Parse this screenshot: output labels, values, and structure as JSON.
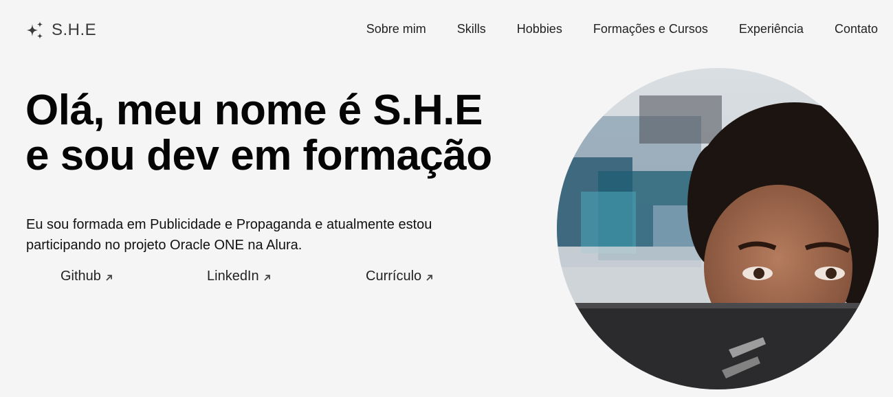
{
  "brand": {
    "name": "S.H.E",
    "icon": "sparkles-icon"
  },
  "nav": [
    {
      "label": "Sobre mim"
    },
    {
      "label": "Skills"
    },
    {
      "label": "Hobbies"
    },
    {
      "label": "Formações e Cursos"
    },
    {
      "label": "Experiência"
    },
    {
      "label": "Contato"
    }
  ],
  "hero": {
    "title_line1": "Olá, meu nome é S.H.E",
    "title_line2": "e sou dev em formação",
    "description_line1": "Eu sou formada em Publicidade e Propaganda e atualmente estou",
    "description_line2": "participando no projeto Oracle ONE na Alura.",
    "links": [
      {
        "label": "Github",
        "icon": "arrow-up-right-icon"
      },
      {
        "label": "LinkedIn",
        "icon": "arrow-up-right-icon"
      },
      {
        "label": "Currículo",
        "icon": "arrow-up-right-icon"
      }
    ]
  },
  "profile_image": {
    "icon": "profile-photo"
  },
  "colors": {
    "background": "#f5f5f5",
    "text": "#111111",
    "logo": "#3a3a3a"
  }
}
